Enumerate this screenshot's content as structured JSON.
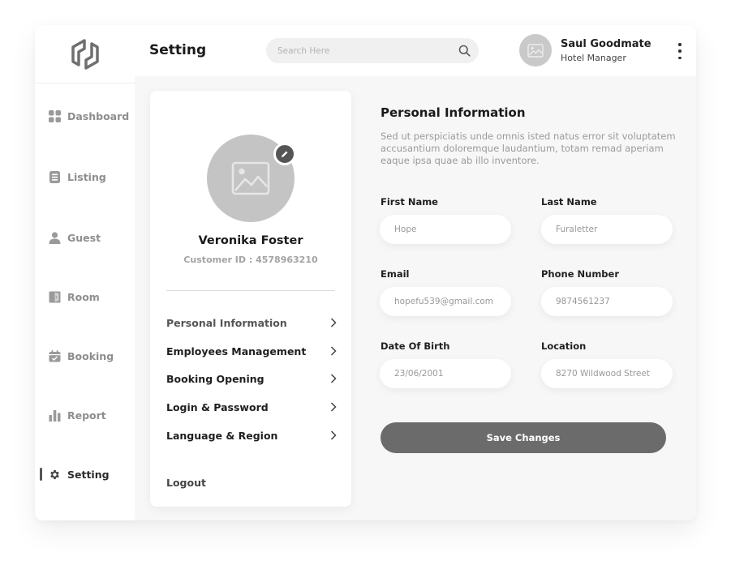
{
  "sidebar": {
    "items": [
      {
        "label": "Dashboard",
        "icon": "dashboard-icon"
      },
      {
        "label": "Listing",
        "icon": "listing-icon"
      },
      {
        "label": "Guest",
        "icon": "guest-icon"
      },
      {
        "label": "Room",
        "icon": "room-icon"
      },
      {
        "label": "Booking",
        "icon": "booking-icon"
      },
      {
        "label": "Report",
        "icon": "report-icon"
      },
      {
        "label": "Setting",
        "icon": "setting-icon",
        "active": true
      }
    ]
  },
  "header": {
    "title": "Setting",
    "search_placeholder": "Search Here",
    "user_name": "Saul Goodmate",
    "user_role": "Hotel Manager"
  },
  "profile": {
    "name": "Veronika Foster",
    "customer_id": "Customer ID : 4578963210",
    "menu": [
      "Personal Information",
      "Employees Management",
      "Booking Opening",
      "Login & Password",
      "Language & Region"
    ],
    "logout_label": "Logout"
  },
  "form": {
    "title": "Personal Information",
    "description": "Sed ut perspiciatis unde omnis isted natus error sit voluptatem accusantium doloremque laudantium, totam remad aperiam eaque ipsa quae ab illo inventore.",
    "fields": [
      {
        "label": "First Name",
        "value": "Hope"
      },
      {
        "label": "Last Name",
        "value": "Furaletter"
      },
      {
        "label": "Email",
        "value": "hopefu539@gmail.com"
      },
      {
        "label": "Phone Number",
        "value": "9874561237"
      },
      {
        "label": "Date Of Birth",
        "value": "23/06/2001"
      },
      {
        "label": "Location",
        "value": "8270 Wildwood Street"
      }
    ],
    "save_label": "Save Changes"
  },
  "colors": {
    "accent": "#6b6b6b",
    "background": "#f7f7f8",
    "muted_text": "#9a9a9a"
  }
}
